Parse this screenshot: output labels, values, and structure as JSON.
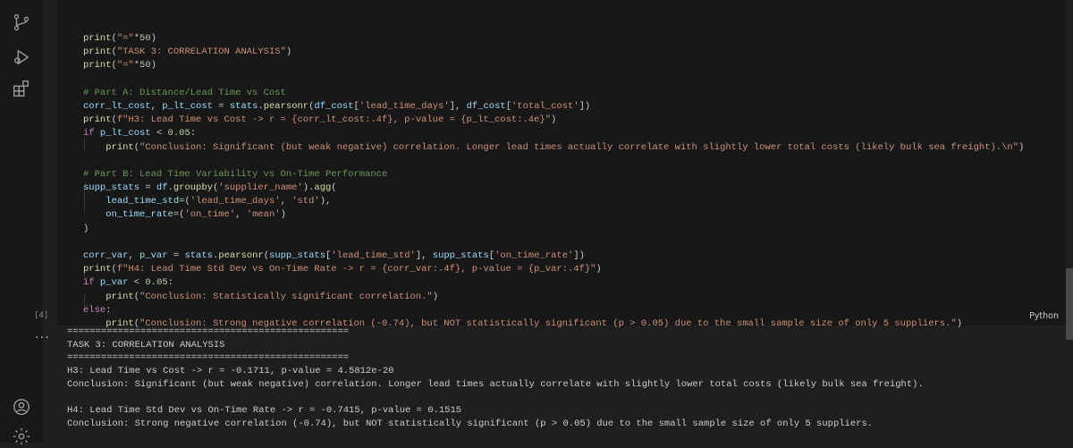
{
  "code_lines": [
    "print(\"=\"*50)",
    "print(\"TASK 3: CORRELATION ANALYSIS\")",
    "print(\"=\"*50)",
    "",
    "# Part A: Distance/Lead Time vs Cost",
    "corr_lt_cost, p_lt_cost = stats.pearsonr(df_cost['lead_time_days'], df_cost['total_cost'])",
    "print(f\"H3: Lead Time vs Cost -> r = {corr_lt_cost:.4f}, p-value = {p_lt_cost:.4e}\")",
    "if p_lt_cost < 0.05:",
    "    print(\"Conclusion: Significant (but weak negative) correlation. Longer lead times actually correlate with slightly lower total costs (likely bulk sea freight).\\n\")",
    "",
    "# Part B: Lead Time Variability vs On-Time Performance",
    "supp_stats = df.groupby('supplier_name').agg(",
    "    lead_time_std=('lead_time_days', 'std'),",
    "    on_time_rate=('on_time', 'mean')",
    ")",
    "",
    "corr_var, p_var = stats.pearsonr(supp_stats['lead_time_std'], supp_stats['on_time_rate'])",
    "print(f\"H4: Lead Time Std Dev vs On-Time Rate -> r = {corr_var:.4f}, p-value = {p_var:.4f}\")",
    "if p_var < 0.05:",
    "    print(\"Conclusion: Statistically significant correlation.\")",
    "else:",
    "    print(\"Conclusion: Strong negative correlation (-0.74), but NOT statistically significant (p > 0.05) due to the small sample size of only 5 suppliers.\")"
  ],
  "execution_count": "[4]",
  "language_label": "Python",
  "more_actions": "...",
  "output_lines": [
    "==================================================",
    "TASK 3: CORRELATION ANALYSIS",
    "==================================================",
    "H3: Lead Time vs Cost -> r = -0.1711, p-value = 4.5812e-20",
    "Conclusion: Significant (but weak negative) correlation. Longer lead times actually correlate with slightly lower total costs (likely bulk sea freight).",
    "",
    "H4: Lead Time Std Dev vs On-Time Rate -> r = -0.7415, p-value = 0.1515",
    "Conclusion: Strong negative correlation (-0.74), but NOT statistically significant (p > 0.05) due to the small sample size of only 5 suppliers."
  ],
  "activity_icons": [
    "source-control-icon",
    "run-debug-icon",
    "extensions-icon",
    "account-icon",
    "settings-icon"
  ],
  "colors": {
    "background": "#1f1f1f",
    "cell_background": "#181818",
    "keyword": "#c586c0",
    "function": "#dcdcaa",
    "string": "#ce9178",
    "comment": "#6a9955",
    "number": "#b5cea8",
    "variable": "#9cdcfe"
  }
}
